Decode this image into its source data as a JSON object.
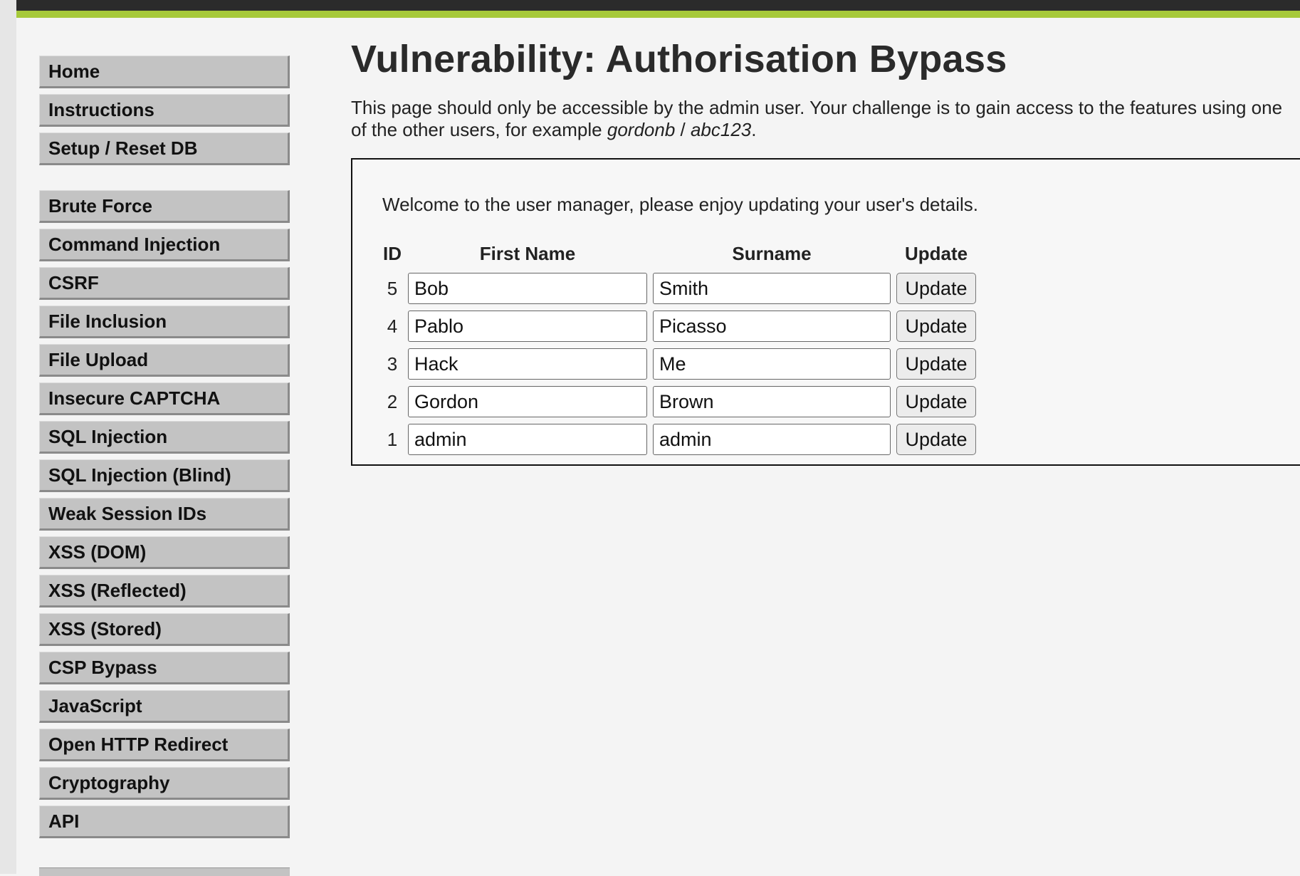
{
  "sidebar": {
    "groups": [
      [
        "Home",
        "Instructions",
        "Setup / Reset DB"
      ],
      [
        "Brute Force",
        "Command Injection",
        "CSRF",
        "File Inclusion",
        "File Upload",
        "Insecure CAPTCHA",
        "SQL Injection",
        "SQL Injection (Blind)",
        "Weak Session IDs",
        "XSS (DOM)",
        "XSS (Reflected)",
        "XSS (Stored)",
        "CSP Bypass",
        "JavaScript",
        "Open HTTP Redirect",
        "Cryptography",
        "API"
      ]
    ]
  },
  "main": {
    "title": "Vulnerability: Authorisation Bypass",
    "intro_text": "This page should only be accessible by the admin user. Your challenge is to gain access to the features using one of the other users, for example ",
    "intro_user": "gordonb",
    "intro_sep": " / ",
    "intro_pass": "abc123",
    "intro_end": ".",
    "welcome": "Welcome to the user manager, please enjoy updating your user's details.",
    "table": {
      "headers": [
        "ID",
        "First Name",
        "Surname",
        "Update"
      ],
      "rows": [
        {
          "id": "5",
          "first": "Bob",
          "surname": "Smith",
          "button": "Update"
        },
        {
          "id": "4",
          "first": "Pablo",
          "surname": "Picasso",
          "button": "Update"
        },
        {
          "id": "3",
          "first": "Hack",
          "surname": "Me",
          "button": "Update"
        },
        {
          "id": "2",
          "first": "Gordon",
          "surname": "Brown",
          "button": "Update"
        },
        {
          "id": "1",
          "first": "admin",
          "surname": "admin",
          "button": "Update"
        }
      ]
    }
  },
  "colors": {
    "topbar": "#2b2b2b",
    "accent": "#a6c93a",
    "menu_bg": "#c3c3c3",
    "page_bg": "#f4f4f4"
  }
}
